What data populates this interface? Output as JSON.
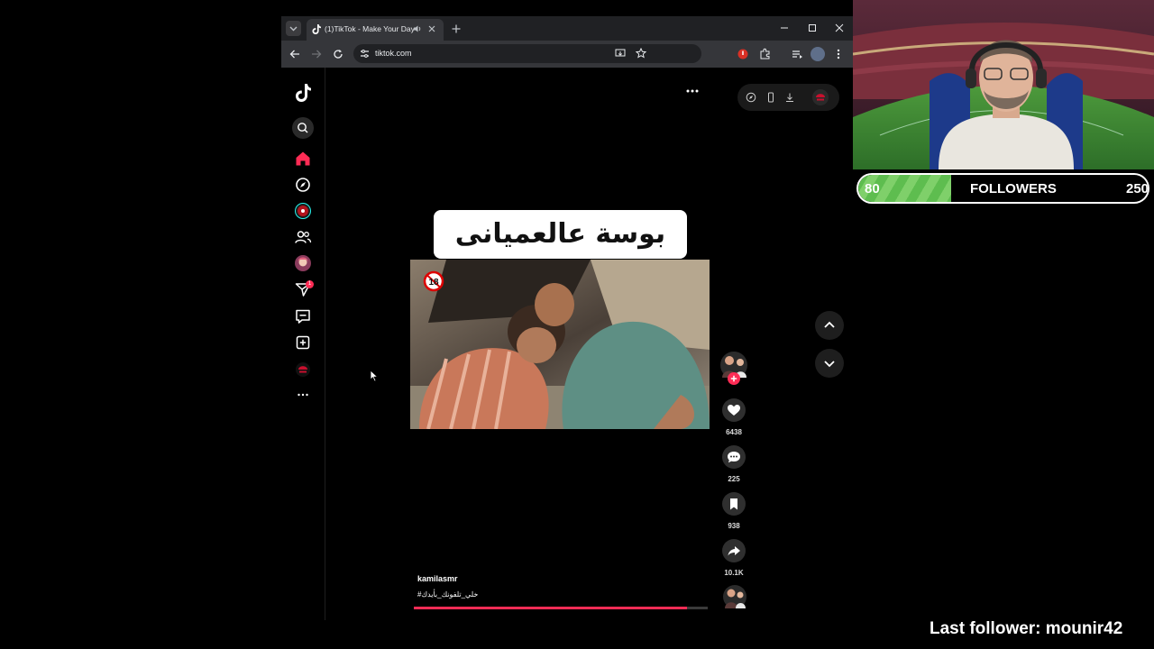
{
  "browser": {
    "tab_title": "(1)TikTok - Make Your Day",
    "url": "tiktok.com"
  },
  "tiktok": {
    "sidebar": {
      "items": [
        "logo",
        "search",
        "home",
        "explore",
        "live",
        "following",
        "profile",
        "messages",
        "inbox",
        "upload",
        "avatar",
        "more"
      ],
      "messages_badge": "1"
    },
    "video": {
      "caption_overlay": "بوسة عالعميانى",
      "rating_badge": "18",
      "author": "kamilasmr",
      "hashtag": "#خلي_تلفونك_بأيدك",
      "progress": 0.93
    },
    "actions": {
      "likes": "6438",
      "comments": "225",
      "saves": "938",
      "shares": "10.1K"
    }
  },
  "stream_overlay": {
    "followers": {
      "label": "FOLLOWERS",
      "current": "80",
      "goal": "250",
      "progress": 0.32
    },
    "last_follower": "Last follower: mounir42"
  },
  "colors": {
    "tiktok_accent": "#fe2c55",
    "goal_fill": "#5ebd4f"
  }
}
